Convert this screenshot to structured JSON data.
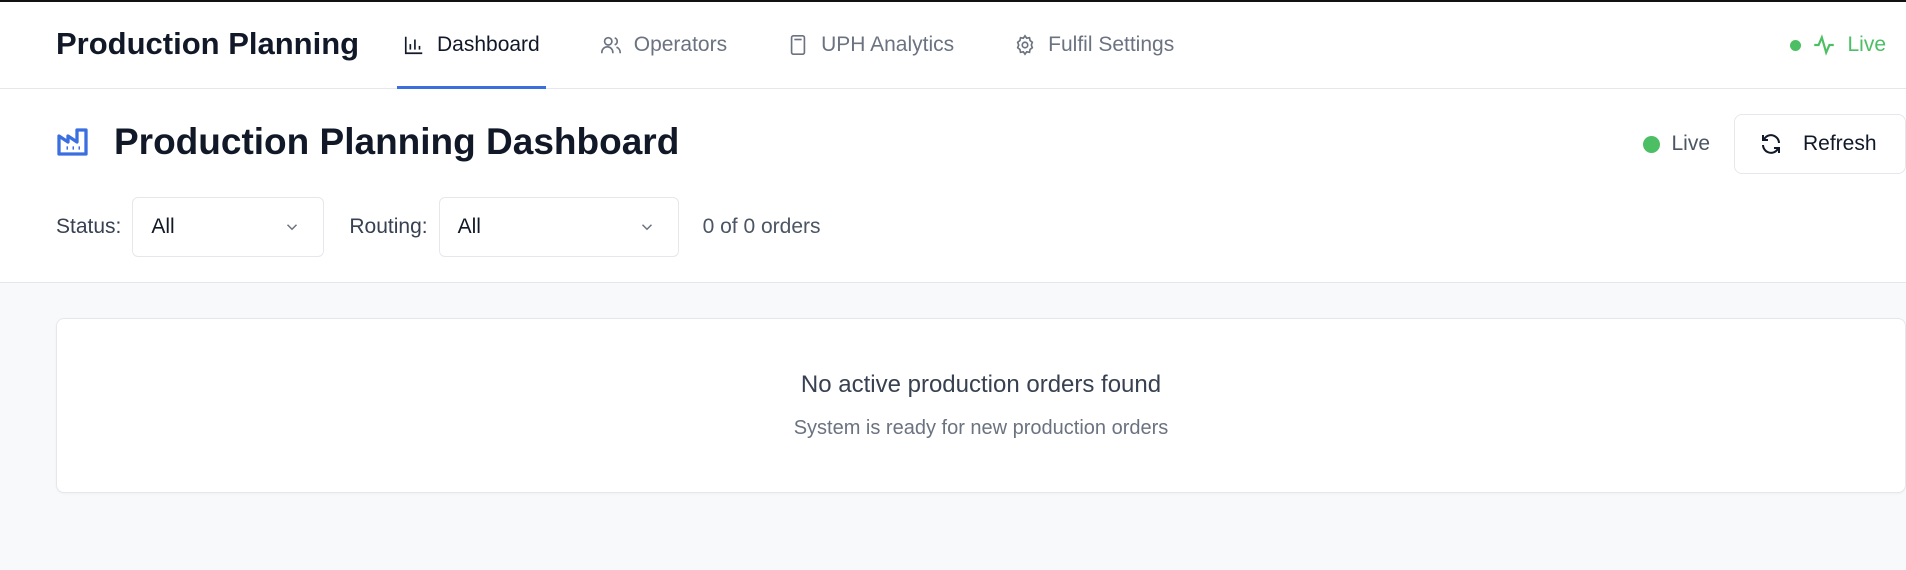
{
  "app": {
    "title": "Production Planning"
  },
  "nav": {
    "tabs": [
      {
        "label": "Dashboard",
        "icon": "bar-chart-icon",
        "active": true
      },
      {
        "label": "Operators",
        "icon": "users-icon",
        "active": false
      },
      {
        "label": "UPH Analytics",
        "icon": "calculator-icon",
        "active": false
      },
      {
        "label": "Fulfil Settings",
        "icon": "gear-icon",
        "active": false
      }
    ],
    "live_label": "Live"
  },
  "header": {
    "title": "Production Planning Dashboard",
    "icon": "factory-icon",
    "live_label": "Live",
    "refresh_label": "Refresh"
  },
  "filters": {
    "status_label": "Status:",
    "status_value": "All",
    "routing_label": "Routing:",
    "routing_value": "All",
    "count_text": "0 of 0 orders"
  },
  "empty_state": {
    "title": "No active production orders found",
    "subtitle": "System is ready for new production orders"
  },
  "colors": {
    "accent": "#3b6fe0",
    "live": "#4cbf64"
  }
}
